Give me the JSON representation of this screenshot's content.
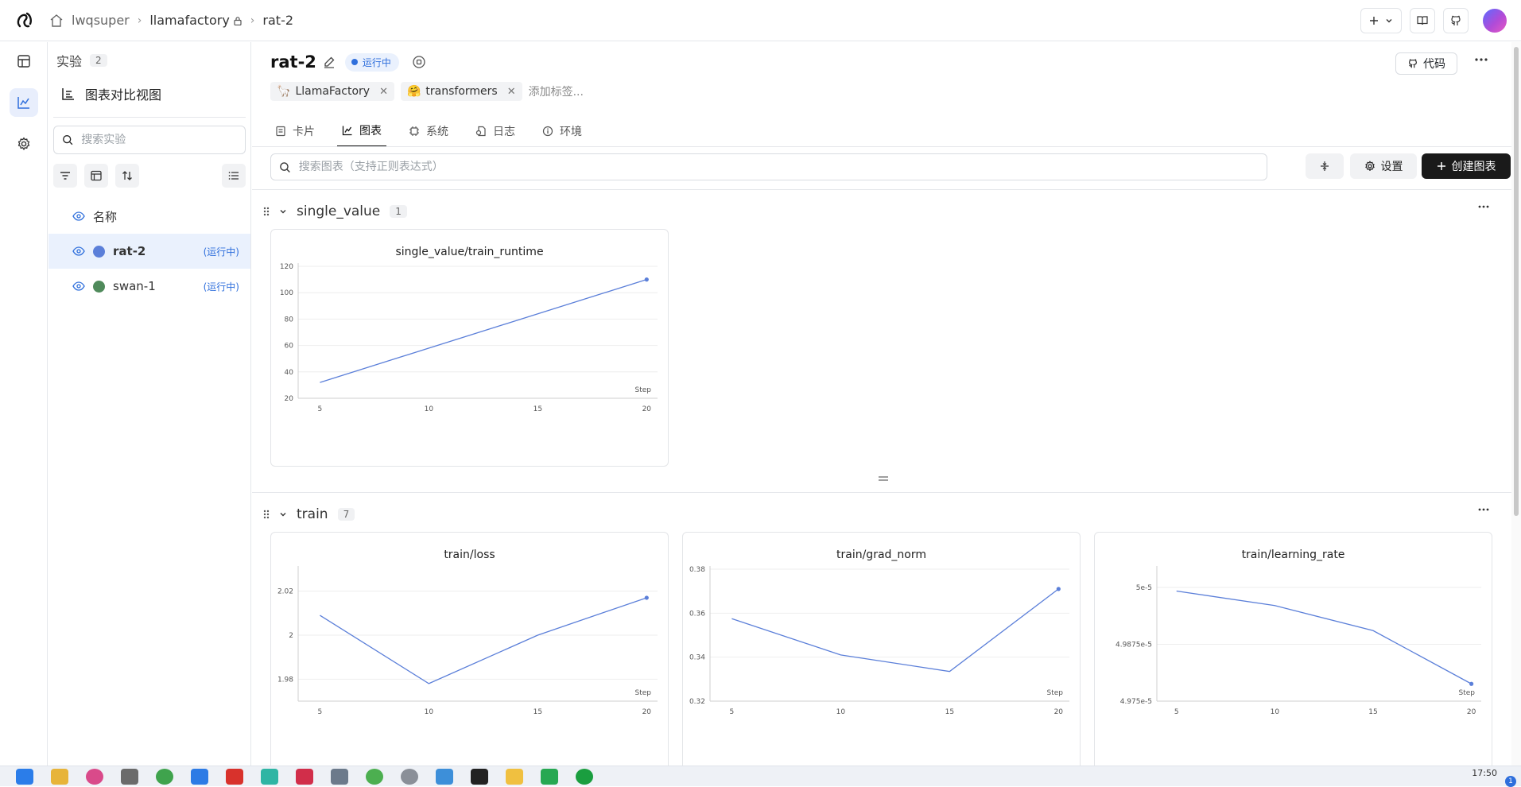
{
  "breadcrumb": {
    "user": "lwqsuper",
    "project": "llamafactory",
    "experiment": "rat-2"
  },
  "sidebar": {
    "header": "实验",
    "count": "2",
    "compare_view": "图表对比视图",
    "search_placeholder": "搜索实验",
    "column_name": "名称",
    "experiments": [
      {
        "name": "rat-2",
        "status": "(运行中)",
        "color": "#5b7fd9"
      },
      {
        "name": "swan-1",
        "status": "(运行中)",
        "color": "#4f8a5b"
      }
    ]
  },
  "main": {
    "title": "rat-2",
    "status": "运行中",
    "tags": [
      "LlamaFactory",
      "transformers"
    ],
    "add_tag": "添加标签...",
    "code_button": "代码",
    "tabs": [
      "卡片",
      "图表",
      "系统",
      "日志",
      "环境"
    ],
    "chart_search_placeholder": "搜索图表（支持正则表达式）",
    "settings_button": "设置",
    "create_button": "创建图表",
    "sections": [
      {
        "name": "single_value",
        "count": "1"
      },
      {
        "name": "train",
        "count": "7"
      }
    ]
  },
  "colors": {
    "series": "#5b7fd9",
    "accent": "#2f6fdc"
  },
  "taskbar": {
    "time": "17:50",
    "badge": "1"
  },
  "chart_data": [
    {
      "type": "line",
      "title": "single_value/train_runtime",
      "xlabel": "Step",
      "x": [
        5,
        20
      ],
      "y": [
        32,
        110
      ],
      "xticks": [
        5,
        10,
        15,
        20
      ],
      "yticks": [
        "20",
        "40",
        "60",
        "80",
        "100",
        "120"
      ],
      "xlim": [
        4,
        20.5
      ],
      "ylim": [
        20,
        120
      ],
      "ytickvals": [
        20,
        40,
        60,
        80,
        100,
        120
      ]
    },
    {
      "type": "line",
      "title": "train/loss",
      "xlabel": "Step",
      "x": [
        5,
        10,
        15,
        20
      ],
      "y": [
        2.009,
        1.978,
        2.0,
        2.017
      ],
      "xticks": [
        5,
        10,
        15,
        20
      ],
      "yticks": [
        "1.98",
        "2",
        "2.02"
      ],
      "xlim": [
        4,
        20.5
      ],
      "ylim": [
        1.97,
        2.03
      ],
      "ytickvals": [
        1.98,
        2.0,
        2.02
      ]
    },
    {
      "type": "line",
      "title": "train/grad_norm",
      "xlabel": "Step",
      "x": [
        5,
        10,
        15,
        20
      ],
      "y": [
        0.3575,
        0.341,
        0.3335,
        0.371
      ],
      "xticks": [
        5,
        10,
        15,
        20
      ],
      "yticks": [
        "0.32",
        "0.34",
        "0.36",
        "0.38"
      ],
      "xlim": [
        4,
        20.5
      ],
      "ylim": [
        0.32,
        0.38
      ],
      "ytickvals": [
        0.32,
        0.34,
        0.36,
        0.38
      ]
    },
    {
      "type": "line",
      "title": "train/learning_rate",
      "xlabel": "Step",
      "x": [
        5,
        10,
        15,
        20
      ],
      "y": [
        4.9992e-05,
        4.996e-05,
        4.9905e-05,
        4.9788e-05
      ],
      "xticks": [
        5,
        10,
        15,
        20
      ],
      "yticks": [
        "4.975e-5",
        "4.9875e-5",
        "5e-5"
      ],
      "xlim": [
        4,
        20.5
      ],
      "ylim": [
        4.975e-05,
        5.004e-05
      ],
      "ytickvals": [
        4.975e-05,
        4.9875e-05,
        5e-05
      ]
    }
  ]
}
